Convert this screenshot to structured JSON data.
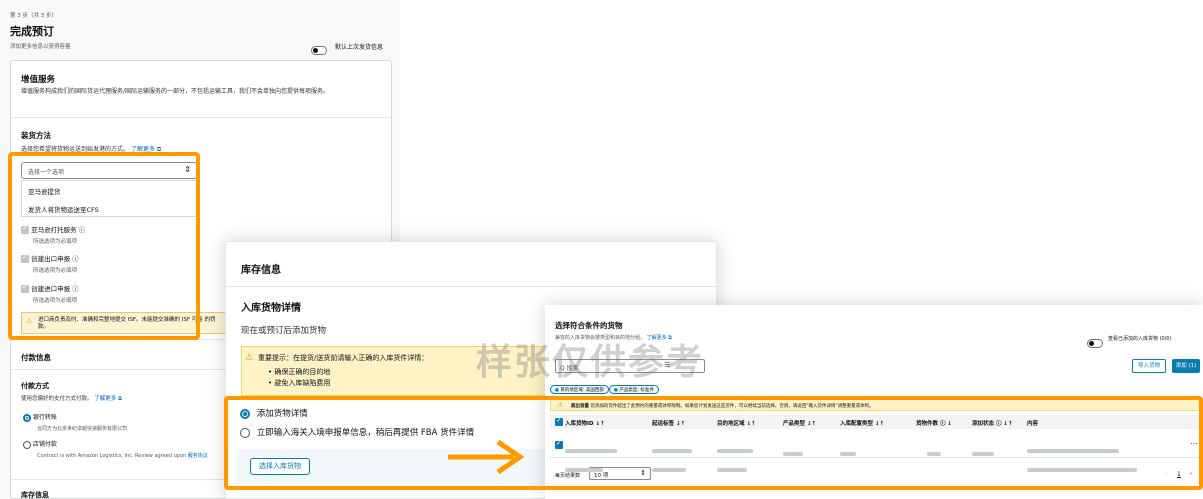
{
  "step": {
    "label": "第 3 步（共 3 步）",
    "title": "完成预订",
    "subtitle": "添加更多信息以获得容量",
    "toggle_label": "默认上次发货信息"
  },
  "value_added": {
    "title": "增值服务",
    "desc": "增值服务构成我们的国际货运代理服务/国际运输服务的一部分，不包括运输工具，我们不会单独向您提供每项服务。"
  },
  "loading": {
    "title": "装货方法",
    "desc": "选择您希望将货物运送到始发港的方式。",
    "learn_more": "了解更多",
    "select_placeholder": "选择一个选项",
    "options": [
      "亚马逊提货",
      "发货人将货物运送至CFS"
    ]
  },
  "services": [
    {
      "label": "亚马逊打托服务",
      "hint": "所选选项为必填项"
    },
    {
      "label": "创建出口申报",
      "hint": "所选选项为必填项"
    },
    {
      "label": "创建进口申报",
      "hint": "所选选项为必填项"
    }
  ],
  "isf_warning": "进口商负责及时、准确和完整地提交 ISF。未能提交准确的 ISF 可能 的罚款。",
  "payment": {
    "section_title": "付款信息",
    "method_title": "付款方式",
    "method_desc": "使用您偏好的支付方式付款。",
    "learn_more": "了解更多",
    "option1": "银行转账",
    "option1_sub": "合同方为北京世纪卓越快递服务有限公司",
    "option2": "店铺付款",
    "option2_sub": "Contract is with Amazon Logistics, Inc. Review agreed upon",
    "option2_link": "服务协议"
  },
  "inventory_footer": "库存信息",
  "inventory": {
    "header": "库存信息",
    "title": "入库货物详情",
    "subtitle": "现在或预订后添加货物",
    "notice_title": "重要提示：在提货/送货前请输入正确的入库货件详情：",
    "notice_items": [
      "确保正确的目的地",
      "避免入库缺陷费用"
    ],
    "option_add": "添加货物详情",
    "option_later": "立即输入海关入境申报单信息，稍后再提供 FBA 货件详情",
    "select_button": "选择入库货物"
  },
  "eligible": {
    "title": "选择符合条件的货物",
    "desc": "兼容的入库货物会按类型和目的地分组。",
    "learn_more": "了解更多",
    "toggle_label": "查看已添加的入库货物 (0/0)",
    "search_placeholder": "Q 搜索",
    "import_button": "导入货物",
    "add_button": "添加 (1)",
    "filters": [
      "目的地区域: 美国西部",
      "产品类型: 标准件"
    ],
    "warning_bold": "超出容量",
    "warning_text": "您添加的货件超出了此预约的重量或体积限制。如果您计划发送这些货件，可以继续当前选择。否则，请返回\"输入货件详情\"调整重量或体积。",
    "columns": [
      "入库货物ID",
      "起运标签",
      "目的地区域",
      "产品类型",
      "入库配置类型",
      "货物件数",
      "添加状态",
      "内容"
    ],
    "rows_per_page_label": "每页结果数",
    "rows_per_page": "10 项",
    "page": "1"
  },
  "watermark": "样张仅供参考"
}
